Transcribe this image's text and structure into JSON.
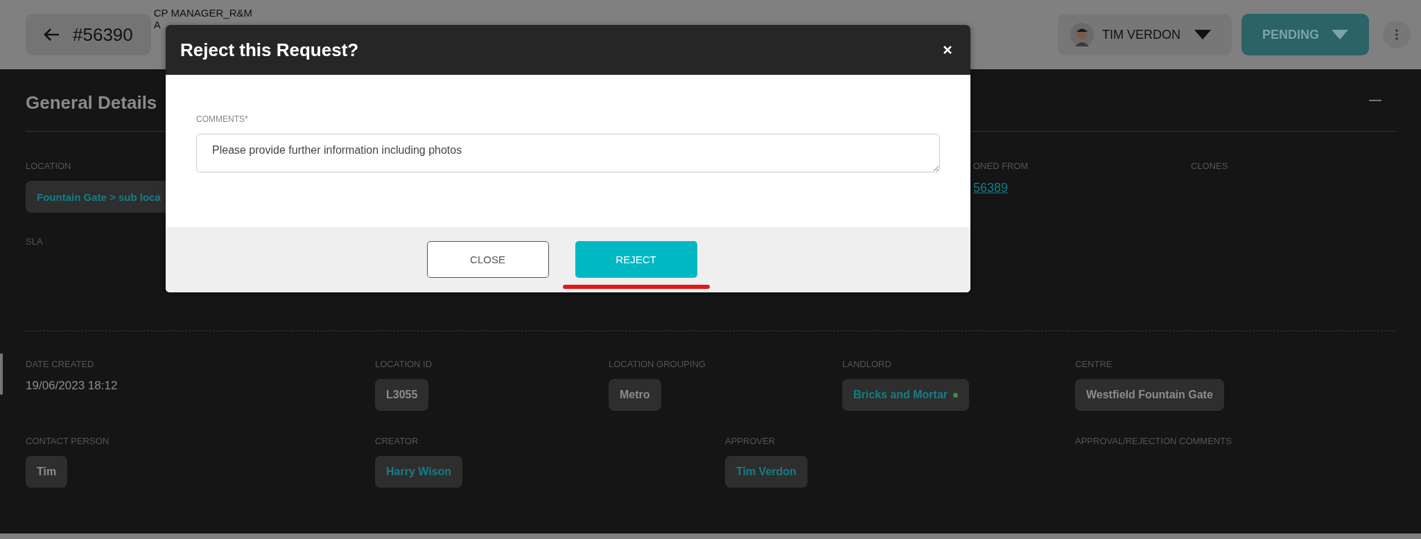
{
  "header": {
    "back_label": "#56390",
    "title_lines": [
      "CP MANAGER_R&M",
      "A"
    ],
    "user": {
      "name": "TIM VERDON"
    },
    "status": {
      "label": "PENDING"
    }
  },
  "section": {
    "title": "General Details",
    "summary_fields": [
      {
        "label": "LOCATION",
        "kind": "link-chip",
        "value": "Fountain Gate > sub loca"
      },
      {
        "label": "ONED FROM",
        "kind": "link",
        "value": "56389"
      },
      {
        "label": "CLONES",
        "kind": "empty"
      }
    ],
    "sla": {
      "label": "SLA"
    },
    "detail_rows": [
      [
        {
          "label": "DATE CREATED",
          "kind": "text",
          "value": "19/06/2023 18:12"
        },
        {
          "label": "LOCATION ID",
          "kind": "chip",
          "value": "L3055"
        },
        {
          "label": "LOCATION GROUPING",
          "kind": "chip",
          "value": "Metro"
        },
        {
          "label": "LANDLORD",
          "kind": "link-chip",
          "value": "Bricks and Mortar",
          "color": "#3f8a4a"
        },
        {
          "label": "CENTRE",
          "kind": "chip",
          "value": "Westfield Fountain Gate"
        }
      ],
      [
        {
          "label": "CONTACT PERSON",
          "kind": "chip",
          "value": "Tim"
        },
        {
          "label": "CREATOR",
          "kind": "link-chip",
          "value": "Harry Wison"
        },
        {
          "label": "APPROVER",
          "kind": "link-chip",
          "value": "Tim Verdon"
        },
        {
          "label": "APPROVAL/REJECTION COMMENTS",
          "kind": "empty"
        }
      ]
    ]
  },
  "modal": {
    "title": "Reject this Request?",
    "field": {
      "label": "COMMENTS*",
      "value": "Please provide further information including photos"
    },
    "buttons": [
      {
        "label": "CLOSE",
        "kind": "secondary",
        "underlined": false
      },
      {
        "label": "REJECT",
        "kind": "primary",
        "underlined": true
      }
    ]
  }
}
